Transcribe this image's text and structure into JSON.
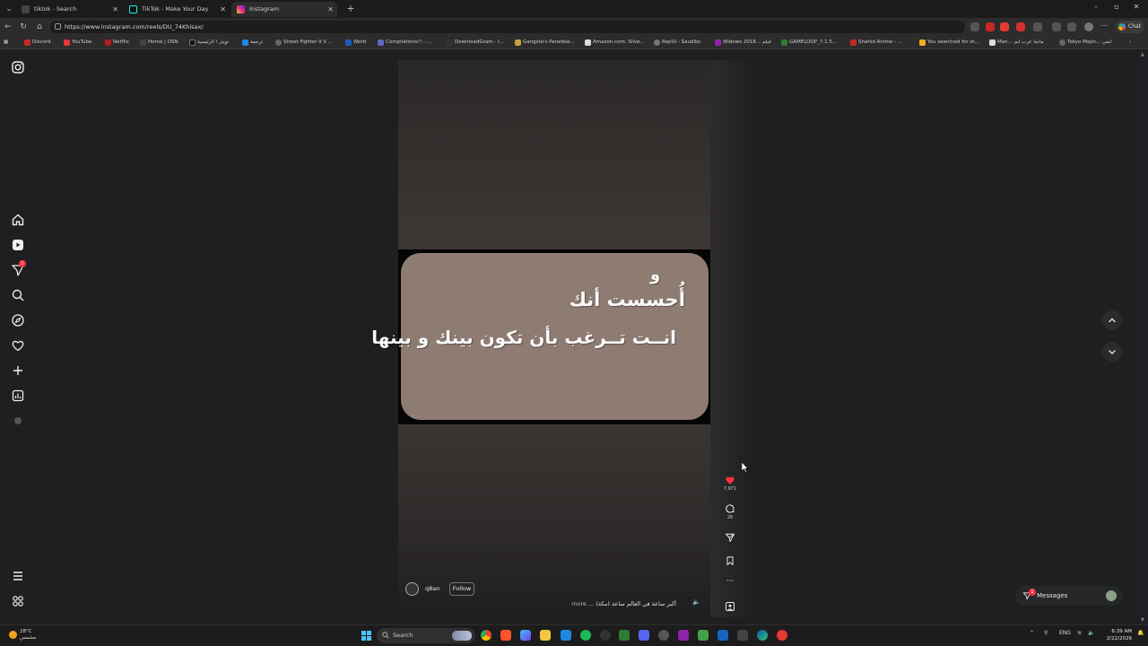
{
  "browser": {
    "tabs": [
      {
        "title": "tiktok - Search",
        "active": false
      },
      {
        "title": "TikTok - Make Your Day",
        "active": false
      },
      {
        "title": "Instagram",
        "active": true
      }
    ],
    "url": "https://www.instagram.com/reels/DU_74Khisax/",
    "chat_label": "Chat",
    "bookmarks": [
      "Discord",
      "YouTube",
      "Netflix",
      "Home | OSN",
      "تويتر \\ الرئيسية",
      "ترجمة",
      "Street Fighter II V ...",
      "Word",
      "Compilations!! - ...",
      "DownloadGram - I...",
      "Gangsta's Paradise...",
      "Amazon.com: Silve...",
      "RepUI - Saudibc",
      "Widows 2018... فيلم",
      "GAMELOOP_7.1.5...",
      "Shahid Anime - ...",
      "You searched for st...",
      "Man... مانجا عرب ايم",
      "Tokyo Majin... انمي"
    ]
  },
  "reel": {
    "text_line1": "و",
    "text_line2": "أُحسست أنك",
    "text_line3": "انــت تــرغب بأن تكون بينك و بينها",
    "author": "q8an",
    "follow_label": "Follow",
    "caption": "أكبر ساعة في العالم ساعة (مكة) ...",
    "caption_more": "more",
    "likes": "7,971",
    "comments": "26"
  },
  "sidenav": {
    "notification_badge": "1"
  },
  "messages": {
    "label": "Messages",
    "badge": "1"
  },
  "taskbar": {
    "weather_temp": "28°C",
    "weather_desc": "مشمس",
    "search_label": "Search",
    "lang": "ENG",
    "time": "6:39 AM",
    "date": "2/22/2026"
  },
  "colors": {
    "accent_like": "#ff3040",
    "card": "#8e7c73",
    "page_bg": "#1e1f21"
  }
}
